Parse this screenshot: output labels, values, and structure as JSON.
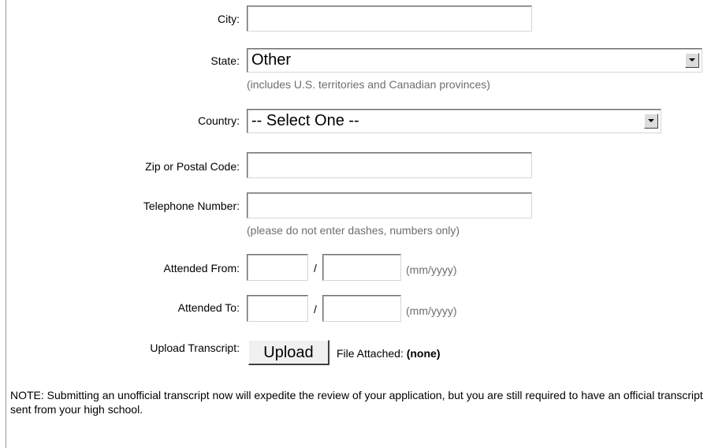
{
  "form": {
    "city": {
      "label": "City:",
      "value": ""
    },
    "state": {
      "label": "State:",
      "selected": "Other",
      "hint": "(includes U.S. territories and Canadian provinces)"
    },
    "country": {
      "label": "Country:",
      "selected": "-- Select One --"
    },
    "zip": {
      "label": "Zip or Postal Code:",
      "value": ""
    },
    "telephone": {
      "label": "Telephone Number:",
      "value": "",
      "hint": "(please do not enter dashes, numbers only)"
    },
    "attended_from": {
      "label": "Attended From:",
      "month": "",
      "year": "",
      "separator": "/",
      "format_hint": "(mm/yyyy)"
    },
    "attended_to": {
      "label": "Attended To:",
      "month": "",
      "year": "",
      "separator": "/",
      "format_hint": "(mm/yyyy)"
    },
    "upload": {
      "label": "Upload Transcript:",
      "button_label": "Upload",
      "file_attached_label": "File Attached:",
      "file_attached_value": "(none)"
    },
    "note": "NOTE: Submitting an unofficial transcript now will expedite the review of your application, but you are still required to have an official transcript sent from your high school."
  },
  "icons": {
    "dropdown_arrow": "chevron-down-icon"
  },
  "colors": {
    "hint_text": "#6e6e6e",
    "left_rule": "#9a9a9a"
  }
}
